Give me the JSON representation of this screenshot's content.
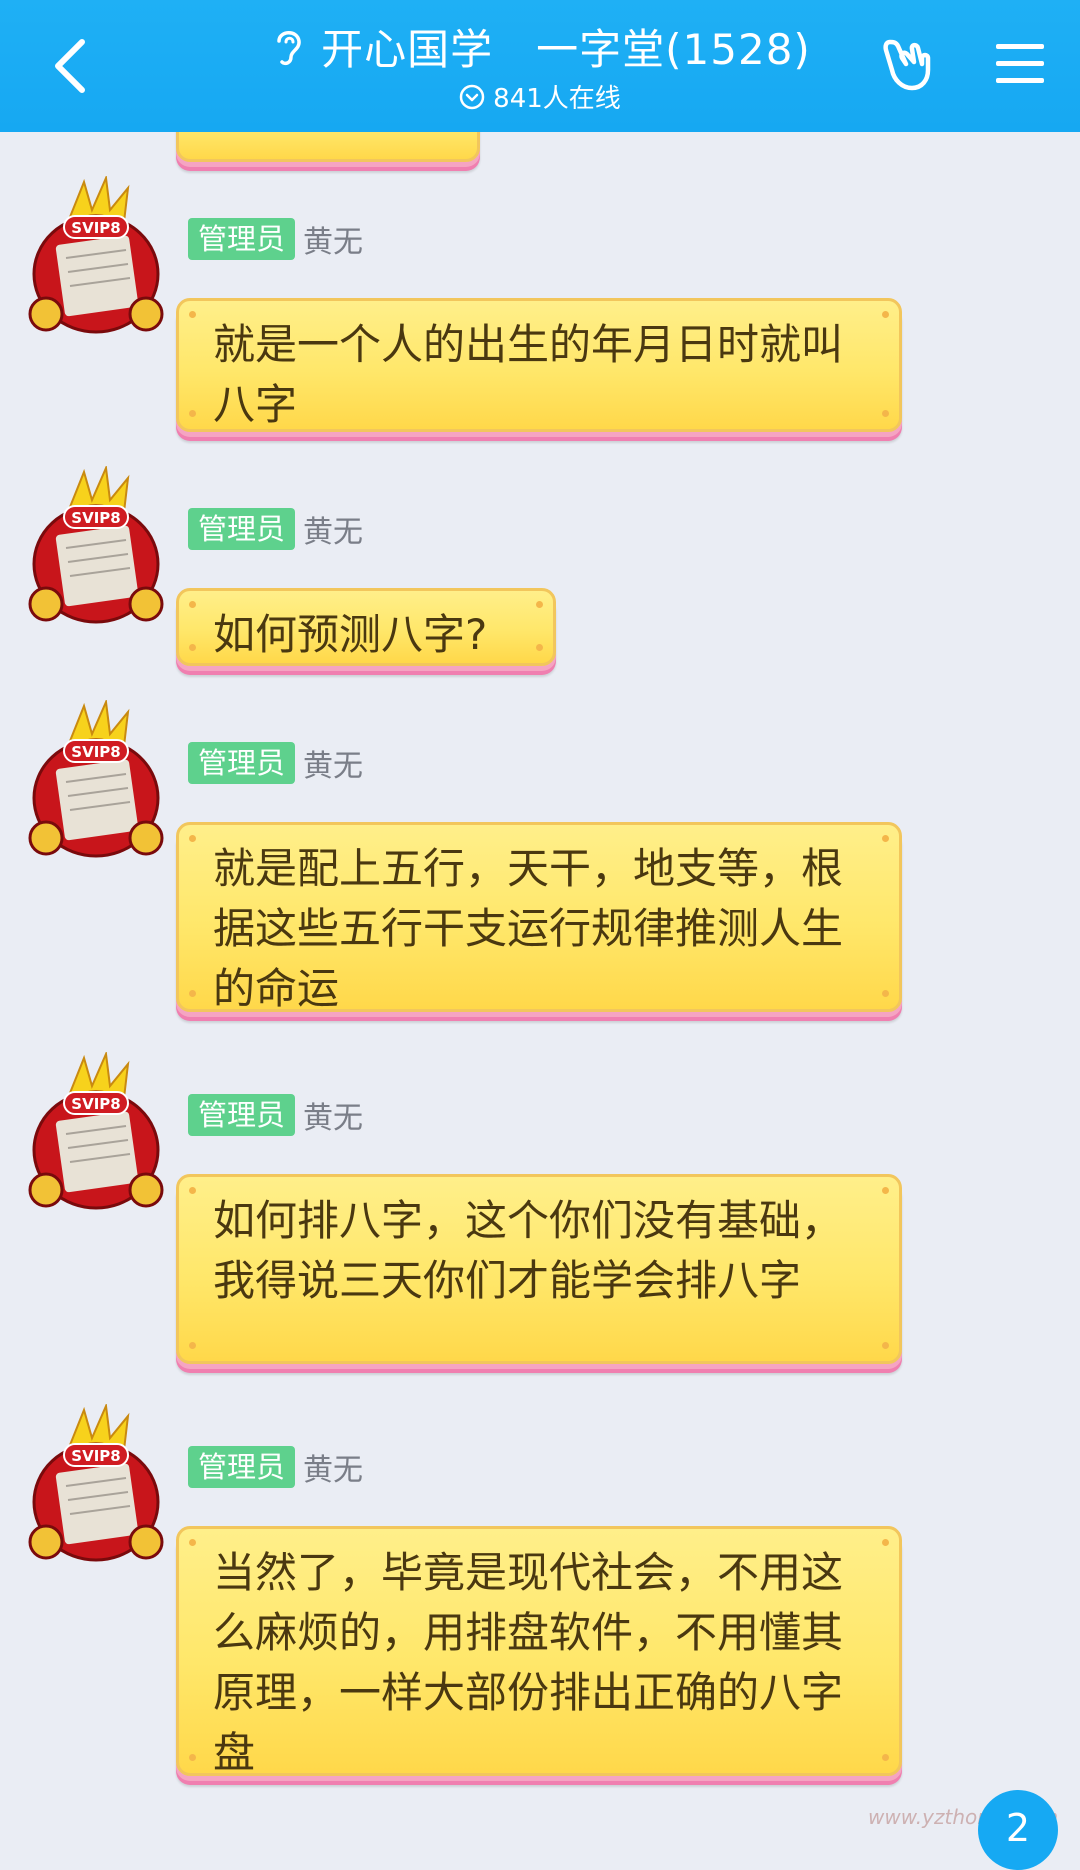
{
  "header": {
    "title": "开心国学　一字堂(1528)",
    "online": "841人在线"
  },
  "messages": [
    {
      "role": "管理员",
      "name": "黄无",
      "text": "就是一个人的出生的年月日时就叫八字"
    },
    {
      "role": "管理员",
      "name": "黄无",
      "text": "如何预测八字?"
    },
    {
      "role": "管理员",
      "name": "黄无",
      "text": "就是配上五行，天干，地支等，根据这些五行干支运行规律推测人生的命运"
    },
    {
      "role": "管理员",
      "name": "黄无",
      "text": "如何排八字，这个你们没有基础，我得说三天你们才能学会排八字"
    },
    {
      "role": "管理员",
      "name": "黄无",
      "text": "当然了，毕竟是现代社会，不用这么麻烦的，用排盘软件，不用懂其原理，一样大部份排出正确的八字盘"
    }
  ],
  "avatar_label": "SVIP8",
  "unread_count": "2",
  "watermark": "www.yzthome.com"
}
